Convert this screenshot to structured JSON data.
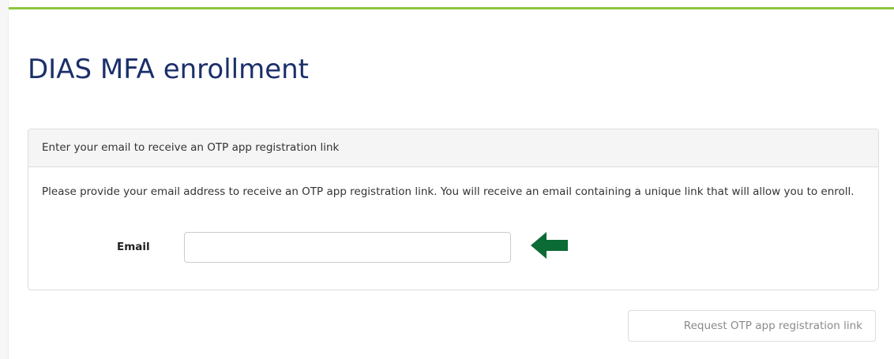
{
  "page": {
    "title": "DIAS MFA enrollment"
  },
  "panel": {
    "heading": "Enter your email to receive an OTP app registration link",
    "description": "Please provide your email address to receive an OTP app registration link. You will receive an email containing a unique link that will allow you to enroll."
  },
  "form": {
    "email_label": "Email",
    "email_value": "",
    "email_placeholder": ""
  },
  "actions": {
    "request_label": "Request OTP app registration link"
  },
  "colors": {
    "title": "#1b2f6b",
    "accent_bar": "#8cc63f",
    "arrow": "#0b6b35"
  },
  "icons": {
    "pointer": "arrow-left-icon"
  }
}
